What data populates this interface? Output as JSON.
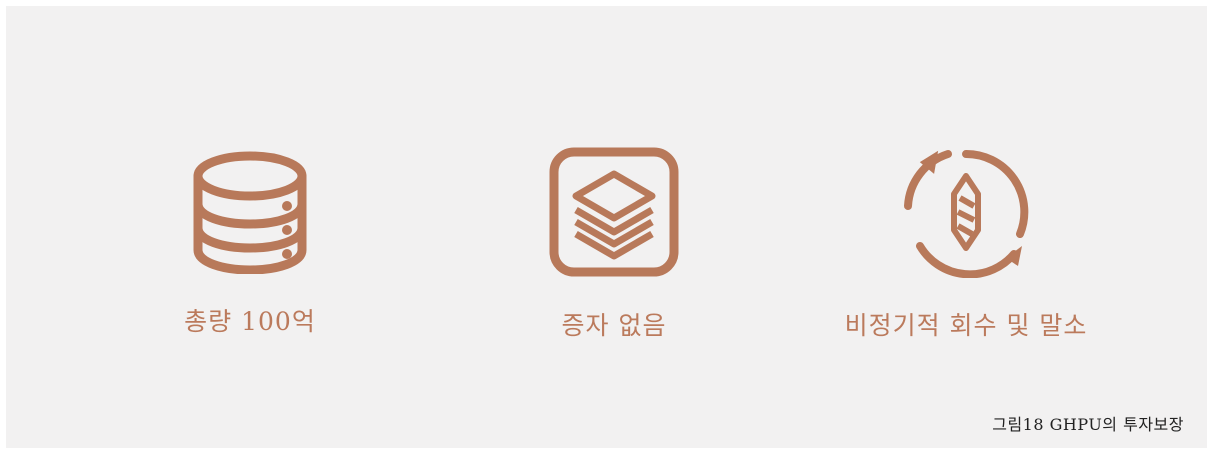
{
  "accent_color": "#b8795a",
  "features": [
    {
      "icon": "database-icon",
      "label": "총량 100억"
    },
    {
      "icon": "layers-icon",
      "label": "증자 없음"
    },
    {
      "icon": "recycle-token-icon",
      "label": "비정기적 회수 및 말소"
    }
  ],
  "caption": "그림18 GHPU의 투자보장"
}
